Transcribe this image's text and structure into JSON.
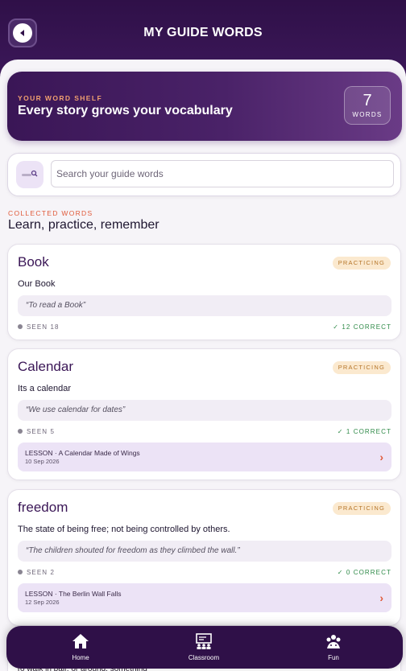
{
  "header": {
    "title": "MY GUIDE WORDS"
  },
  "banner": {
    "kicker": "YOUR WORD SHELF",
    "title": "Every story grows your vocabulary",
    "count": "7",
    "count_label": "WORDS"
  },
  "search": {
    "placeholder": "Search your guide words",
    "value": ""
  },
  "section": {
    "kicker": "COLLECTED WORDS",
    "title": "Learn, practice, remember"
  },
  "words": [
    {
      "word": "Book",
      "status": "PRACTICING",
      "definition": "Our Book",
      "example": "“To read a Book”",
      "seen": "SEEN 18",
      "correct": "✓ 12 CORRECT"
    },
    {
      "word": "Calendar",
      "status": "PRACTICING",
      "definition": "Its a calendar",
      "example": "“We use calendar for dates”",
      "seen": "SEEN 5",
      "correct": "✓ 1 CORRECT",
      "lesson": {
        "title": "LESSON · A Calendar Made of Wings",
        "date": "10 Sep 2026"
      }
    },
    {
      "word": "freedom",
      "status": "PRACTICING",
      "definition": "The state of being free; not being controlled by others.",
      "example": "“The children shouted for freedom as they climbed the wall.”",
      "seen": "SEEN 2",
      "correct": "✓ 0 CORRECT",
      "lesson": {
        "title": "LESSON · The Berlin Wall Falls",
        "date": "12 Sep 2026"
      }
    }
  ],
  "peek_text": "To walk in pair, or around, something",
  "nav": [
    {
      "label": "Home",
      "icon": "home-icon"
    },
    {
      "label": "Classroom",
      "icon": "classroom-icon"
    },
    {
      "label": "Fun",
      "icon": "fun-icon"
    }
  ],
  "colors": {
    "header_bg": "#2f1048",
    "accent_orange": "#e05a3a",
    "badge_bg": "#fbe9cf",
    "correct_green": "#2f8a48",
    "lesson_bg": "#ece3f6"
  }
}
